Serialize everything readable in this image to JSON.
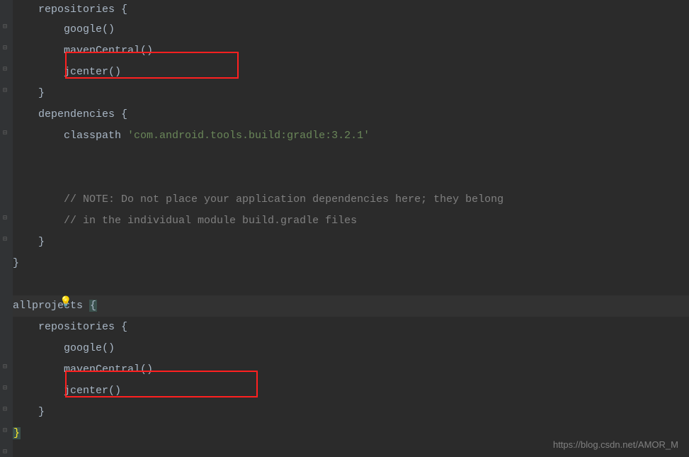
{
  "code": {
    "line1_repositories": "    repositories ",
    "line1_brace": "{",
    "line2_google": "        google()",
    "line3_mavenCentral": "        mavenCentral()",
    "line4_jcenter": "        jcenter()",
    "line5_close": "    }",
    "line6_dependencies": "    dependencies ",
    "line6_brace": "{",
    "line7_classpath": "        classpath ",
    "line7_string": "'com.android.tools.build:gradle:3.2.1'",
    "line10_comment": "        // NOTE: Do not place your application dependencies here; they belong",
    "line11_comment": "        // in the individual module build.gradle files",
    "line12_close": "    }",
    "line13_close": "}",
    "line15_allprojects": "allprojects ",
    "line15_brace": "{",
    "line16_repositories": "    repositories ",
    "line16_brace": "{",
    "line17_google": "        google()",
    "line18_mavenCentral": "        mavenCentral()",
    "line19_jcenter": "        jcenter()",
    "line20_close": "    }",
    "line21_close": "}"
  },
  "watermark": "https://blog.csdn.net/AMOR_M",
  "bulb": "💡"
}
